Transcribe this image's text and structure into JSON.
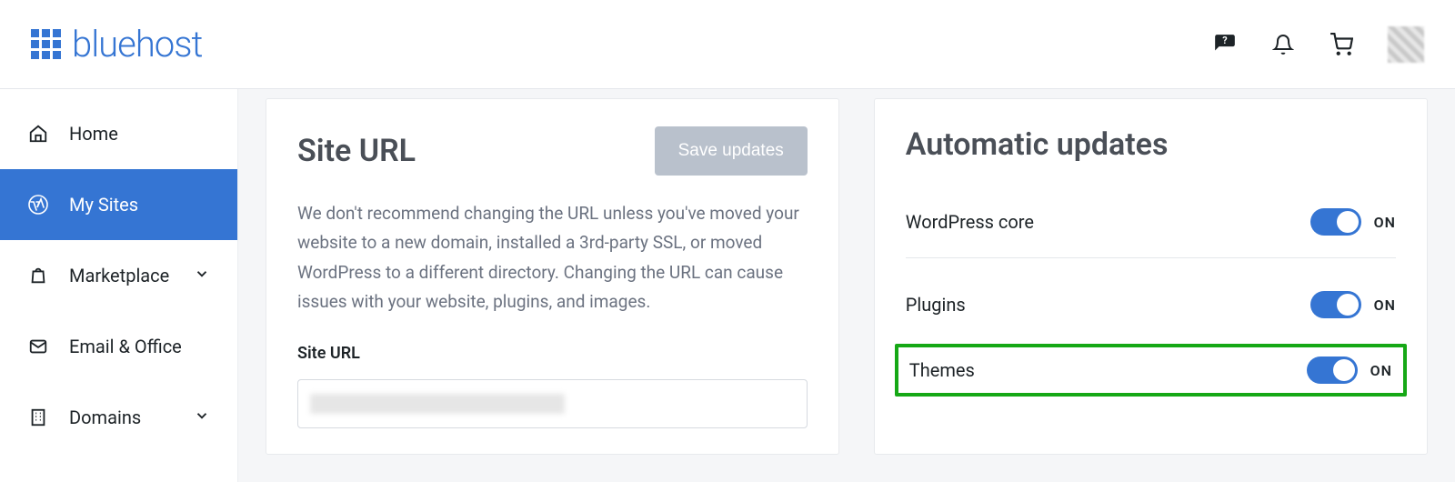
{
  "brand": "bluehost",
  "sidebar": {
    "items": [
      {
        "label": "Home"
      },
      {
        "label": "My Sites"
      },
      {
        "label": "Marketplace"
      },
      {
        "label": "Email & Office"
      },
      {
        "label": "Domains"
      }
    ]
  },
  "site_url_card": {
    "title": "Site URL",
    "save_button": "Save updates",
    "description": "We don't recommend changing the URL unless you've moved your website to a new domain, installed a 3rd-party SSL, or moved WordPress to a different directory. Changing the URL can cause issues with your website, plugins, and images.",
    "field_label": "Site URL",
    "field_value": ""
  },
  "auto_updates_card": {
    "title": "Automatic updates",
    "rows": [
      {
        "label": "WordPress core",
        "state": "ON"
      },
      {
        "label": "Plugins",
        "state": "ON"
      },
      {
        "label": "Themes",
        "state": "ON"
      }
    ]
  }
}
